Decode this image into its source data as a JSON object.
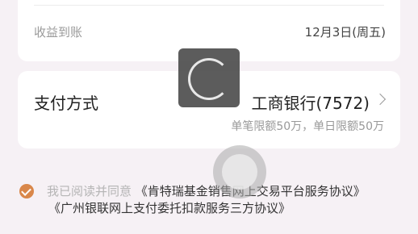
{
  "income": {
    "label": "收益到账",
    "value": "12月3日(周五)"
  },
  "payment": {
    "label": "支付方式",
    "bank": "工商银行(7572)",
    "limit": "单笔限额50万，单日限额50万"
  },
  "agreement": {
    "checked": true,
    "prefix": "我已阅读并同意",
    "link1": "《肯特瑞基金销售网上交易平台服务协议》",
    "link2": "《广州银联网上支付委托扣款服务三方协议》"
  },
  "colors": {
    "accent": "#d9874a",
    "background": "#f6f1f5"
  },
  "icons": {
    "chevron": "chevron-right-icon",
    "check": "check-icon",
    "spinner": "loading-spinner-icon"
  }
}
